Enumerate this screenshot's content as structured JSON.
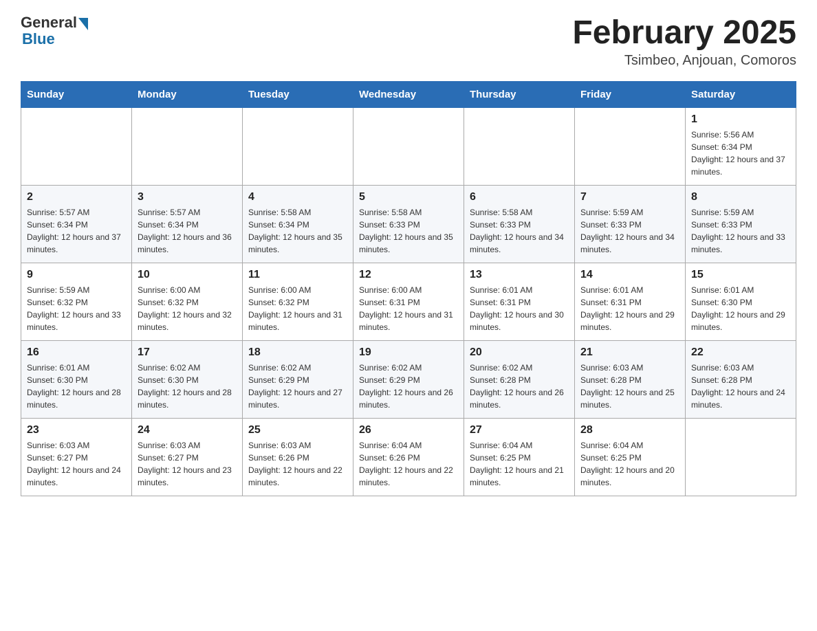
{
  "header": {
    "logo_general": "General",
    "logo_blue": "Blue",
    "month_title": "February 2025",
    "location": "Tsimbeo, Anjouan, Comoros"
  },
  "days_of_week": [
    "Sunday",
    "Monday",
    "Tuesday",
    "Wednesday",
    "Thursday",
    "Friday",
    "Saturday"
  ],
  "weeks": [
    [
      {
        "day": "",
        "info": ""
      },
      {
        "day": "",
        "info": ""
      },
      {
        "day": "",
        "info": ""
      },
      {
        "day": "",
        "info": ""
      },
      {
        "day": "",
        "info": ""
      },
      {
        "day": "",
        "info": ""
      },
      {
        "day": "1",
        "info": "Sunrise: 5:56 AM\nSunset: 6:34 PM\nDaylight: 12 hours and 37 minutes."
      }
    ],
    [
      {
        "day": "2",
        "info": "Sunrise: 5:57 AM\nSunset: 6:34 PM\nDaylight: 12 hours and 37 minutes."
      },
      {
        "day": "3",
        "info": "Sunrise: 5:57 AM\nSunset: 6:34 PM\nDaylight: 12 hours and 36 minutes."
      },
      {
        "day": "4",
        "info": "Sunrise: 5:58 AM\nSunset: 6:34 PM\nDaylight: 12 hours and 35 minutes."
      },
      {
        "day": "5",
        "info": "Sunrise: 5:58 AM\nSunset: 6:33 PM\nDaylight: 12 hours and 35 minutes."
      },
      {
        "day": "6",
        "info": "Sunrise: 5:58 AM\nSunset: 6:33 PM\nDaylight: 12 hours and 34 minutes."
      },
      {
        "day": "7",
        "info": "Sunrise: 5:59 AM\nSunset: 6:33 PM\nDaylight: 12 hours and 34 minutes."
      },
      {
        "day": "8",
        "info": "Sunrise: 5:59 AM\nSunset: 6:33 PM\nDaylight: 12 hours and 33 minutes."
      }
    ],
    [
      {
        "day": "9",
        "info": "Sunrise: 5:59 AM\nSunset: 6:32 PM\nDaylight: 12 hours and 33 minutes."
      },
      {
        "day": "10",
        "info": "Sunrise: 6:00 AM\nSunset: 6:32 PM\nDaylight: 12 hours and 32 minutes."
      },
      {
        "day": "11",
        "info": "Sunrise: 6:00 AM\nSunset: 6:32 PM\nDaylight: 12 hours and 31 minutes."
      },
      {
        "day": "12",
        "info": "Sunrise: 6:00 AM\nSunset: 6:31 PM\nDaylight: 12 hours and 31 minutes."
      },
      {
        "day": "13",
        "info": "Sunrise: 6:01 AM\nSunset: 6:31 PM\nDaylight: 12 hours and 30 minutes."
      },
      {
        "day": "14",
        "info": "Sunrise: 6:01 AM\nSunset: 6:31 PM\nDaylight: 12 hours and 29 minutes."
      },
      {
        "day": "15",
        "info": "Sunrise: 6:01 AM\nSunset: 6:30 PM\nDaylight: 12 hours and 29 minutes."
      }
    ],
    [
      {
        "day": "16",
        "info": "Sunrise: 6:01 AM\nSunset: 6:30 PM\nDaylight: 12 hours and 28 minutes."
      },
      {
        "day": "17",
        "info": "Sunrise: 6:02 AM\nSunset: 6:30 PM\nDaylight: 12 hours and 28 minutes."
      },
      {
        "day": "18",
        "info": "Sunrise: 6:02 AM\nSunset: 6:29 PM\nDaylight: 12 hours and 27 minutes."
      },
      {
        "day": "19",
        "info": "Sunrise: 6:02 AM\nSunset: 6:29 PM\nDaylight: 12 hours and 26 minutes."
      },
      {
        "day": "20",
        "info": "Sunrise: 6:02 AM\nSunset: 6:28 PM\nDaylight: 12 hours and 26 minutes."
      },
      {
        "day": "21",
        "info": "Sunrise: 6:03 AM\nSunset: 6:28 PM\nDaylight: 12 hours and 25 minutes."
      },
      {
        "day": "22",
        "info": "Sunrise: 6:03 AM\nSunset: 6:28 PM\nDaylight: 12 hours and 24 minutes."
      }
    ],
    [
      {
        "day": "23",
        "info": "Sunrise: 6:03 AM\nSunset: 6:27 PM\nDaylight: 12 hours and 24 minutes."
      },
      {
        "day": "24",
        "info": "Sunrise: 6:03 AM\nSunset: 6:27 PM\nDaylight: 12 hours and 23 minutes."
      },
      {
        "day": "25",
        "info": "Sunrise: 6:03 AM\nSunset: 6:26 PM\nDaylight: 12 hours and 22 minutes."
      },
      {
        "day": "26",
        "info": "Sunrise: 6:04 AM\nSunset: 6:26 PM\nDaylight: 12 hours and 22 minutes."
      },
      {
        "day": "27",
        "info": "Sunrise: 6:04 AM\nSunset: 6:25 PM\nDaylight: 12 hours and 21 minutes."
      },
      {
        "day": "28",
        "info": "Sunrise: 6:04 AM\nSunset: 6:25 PM\nDaylight: 12 hours and 20 minutes."
      },
      {
        "day": "",
        "info": ""
      }
    ]
  ]
}
